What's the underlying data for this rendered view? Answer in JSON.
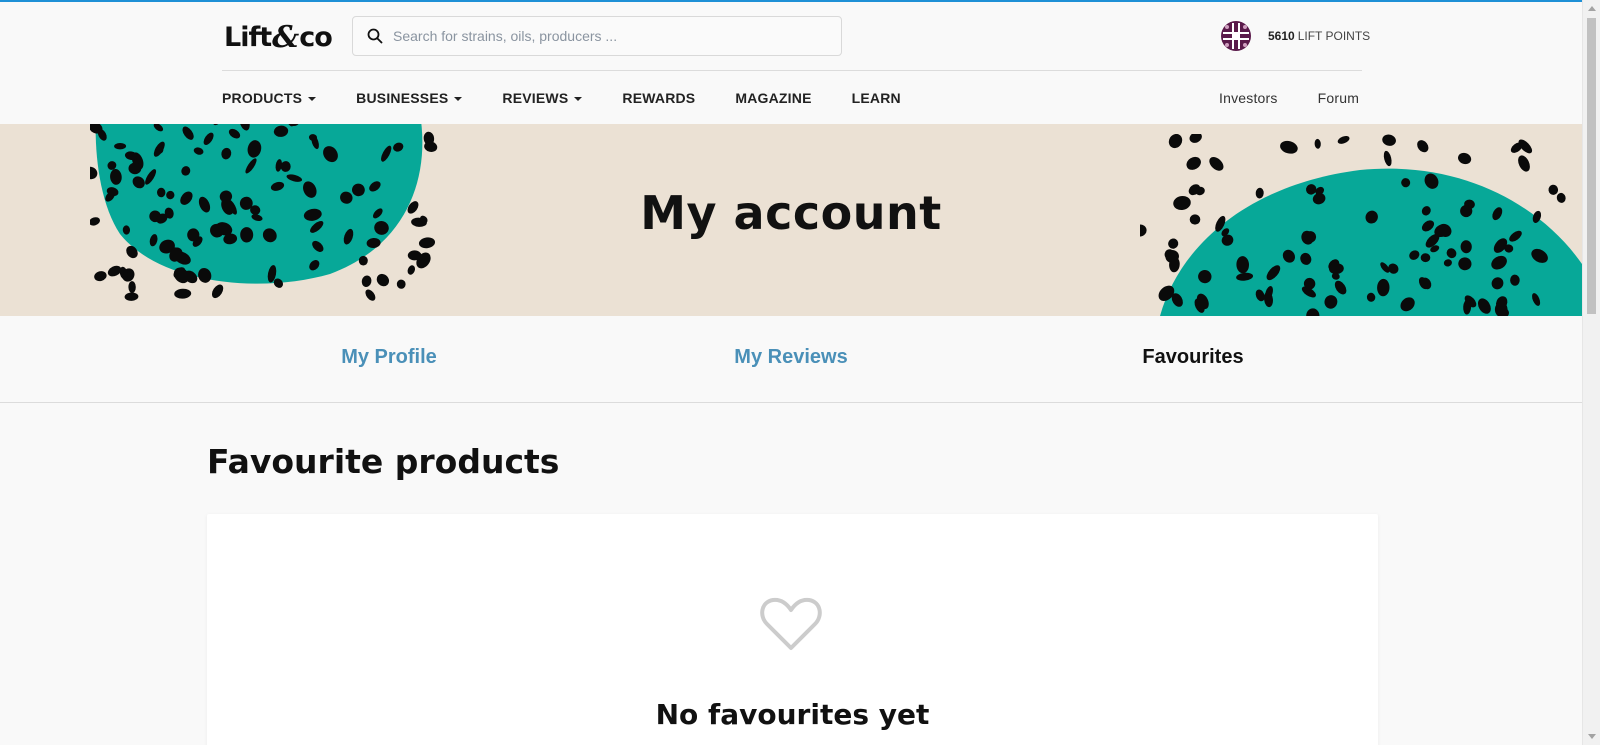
{
  "header": {
    "logo_left": "Lift",
    "logo_amp": "&",
    "logo_right": "co",
    "search_placeholder": "Search for strains, oils, producers ...",
    "points_value": "5610",
    "points_label": "LIFT POINTS"
  },
  "nav": {
    "items": [
      {
        "label": "PRODUCTS",
        "dropdown": true
      },
      {
        "label": "BUSINESSES",
        "dropdown": true
      },
      {
        "label": "REVIEWS",
        "dropdown": true
      },
      {
        "label": "REWARDS",
        "dropdown": false
      },
      {
        "label": "MAGAZINE",
        "dropdown": false
      },
      {
        "label": "LEARN",
        "dropdown": false
      }
    ],
    "right": [
      {
        "label": "Investors"
      },
      {
        "label": "Forum"
      }
    ]
  },
  "banner": {
    "title": "My account"
  },
  "tabs": [
    {
      "label": "My Profile",
      "active": false
    },
    {
      "label": "My Reviews",
      "active": false
    },
    {
      "label": "Favourites",
      "active": true
    }
  ],
  "main": {
    "section_title": "Favourite products",
    "empty_title": "No favourites yet"
  },
  "colors": {
    "accent_blue": "#1e90d6",
    "tab_link": "#4a90b8",
    "teal": "#07a898",
    "banner_bg": "#ebe1d4",
    "badge": "#5a1a4a"
  },
  "icons": {
    "search": "search-icon",
    "badge": "lift-points-badge-icon",
    "heart": "heart-outline-icon"
  }
}
